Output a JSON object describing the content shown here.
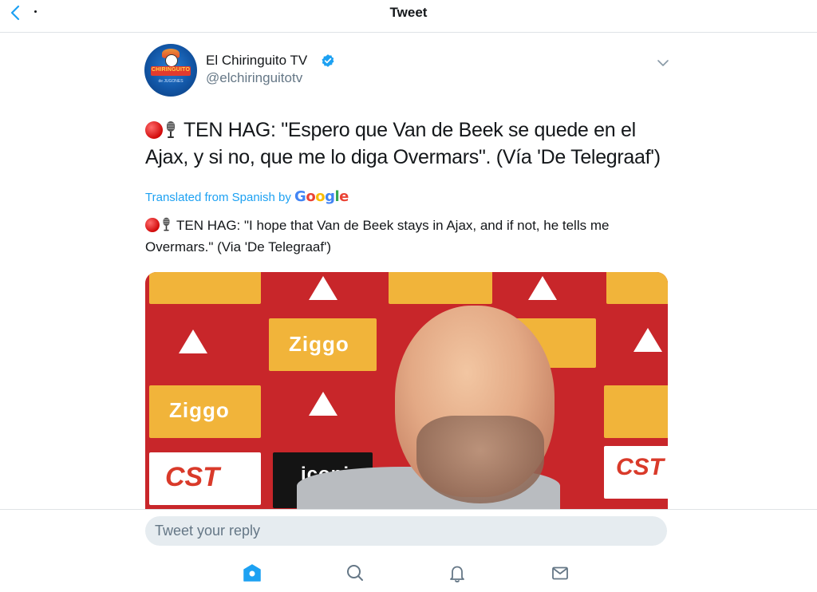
{
  "header": {
    "title": "Tweet"
  },
  "author": {
    "display_name": "El Chiringuito TV",
    "handle": "@elchiringuitotv",
    "avatar_text": "CHIRINGUITO",
    "avatar_subtext": "de JUGONES"
  },
  "tweet": {
    "text": "TEN HAG: \"Espero que Van de Beek se quede en el Ajax, y si no, que me lo diga Overmars\". (Vía 'De Telegraaf')",
    "translated_label": "Translated from Spanish by",
    "translated_brand": "Google",
    "translation": "TEN HAG: \"I hope that Van de Beek stays in Ajax, and if not, he tells me Overmars.\" (Via 'De Telegraaf')"
  },
  "media": {
    "sponsor_1": "Ziggo",
    "sponsor_2": "CST",
    "sponsor_3": "iconix"
  },
  "reply": {
    "placeholder": "Tweet your reply"
  },
  "colors": {
    "accent": "#1da1f2",
    "text": "#14171a",
    "muted": "#657786"
  },
  "icons": [
    "back-chevron-icon",
    "verified-badge-icon",
    "chevron-down-icon",
    "home-icon",
    "search-icon",
    "notifications-bell-icon",
    "messages-mail-icon"
  ]
}
